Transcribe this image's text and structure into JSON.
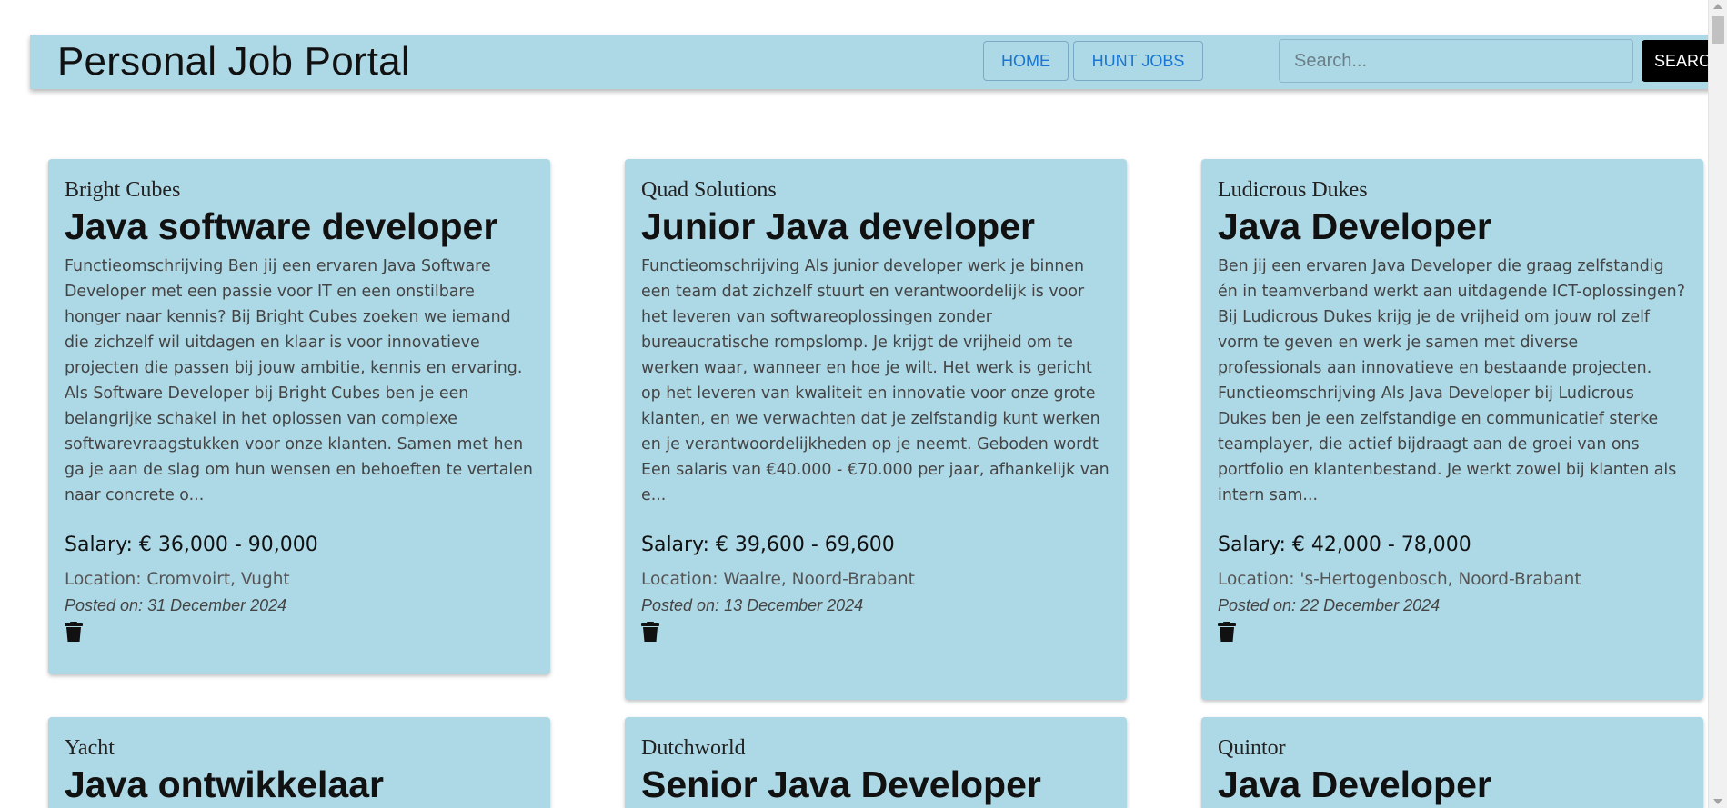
{
  "header": {
    "brand": "Personal Job Portal",
    "nav": [
      {
        "label": "HOME"
      },
      {
        "label": "HUNT JOBS"
      }
    ],
    "search": {
      "placeholder": "Search...",
      "button_label": "Search"
    }
  },
  "jobs": [
    {
      "company": "Bright Cubes",
      "title": "Java software developer",
      "description": "Functieomschrijving Ben jij een ervaren Java Software Developer met een passie voor IT en een onstilbare honger naar kennis? Bij Bright Cubes zoeken we iemand die zichzelf wil uitdagen en klaar is voor innovatieve projecten die passen bij jouw ambitie, kennis en ervaring. Als Software Developer bij Bright Cubes ben je een belangrijke schakel in het oplossen van complexe softwarevraagstukken voor onze klanten. Samen met hen ga je aan de slag om hun wensen en behoeften te vertalen naar concrete o...",
      "salary": "Salary: € 36,000 - 90,000",
      "location": "Location: Cromvoirt, Vught",
      "posted": "Posted on: 31 December 2024",
      "icon": "trash-icon"
    },
    {
      "company": "Quad Solutions",
      "title": "Junior Java developer",
      "description": "Functieomschrijving Als junior developer werk je binnen een team dat zichzelf stuurt en verantwoordelijk is voor het leveren van softwareoplossingen zonder bureaucratische rompslomp. Je krijgt de vrijheid om te werken waar, wanneer en hoe je wilt. Het werk is gericht op het leveren van kwaliteit en innovatie voor onze grote klanten, en we verwachten dat je zelfstandig kunt werken en je verantwoordelijkheden op je neemt. Geboden wordt Een salaris van €40.000 - €70.000 per jaar, afhankelijk van e...",
      "salary": "Salary: € 39,600 - 69,600",
      "location": "Location: Waalre, Noord-Brabant",
      "posted": "Posted on: 13 December 2024",
      "icon": "trash-icon"
    },
    {
      "company": "Ludicrous Dukes",
      "title": "Java Developer",
      "description": "Ben jij een ervaren Java Developer die graag zelfstandig én in teamverband werkt aan uitdagende ICT-oplossingen? Bij Ludicrous Dukes krijg je de vrijheid om jouw rol zelf vorm te geven en werk je samen met diverse professionals aan innovatieve en bestaande projecten. Functieomschrijving Als Java Developer bij Ludicrous Dukes ben je een zelfstandige en communicatief sterke teamplayer, die actief bijdraagt aan de groei van ons portfolio en klantenbestand. Je werkt zowel bij klanten als intern sam...",
      "salary": "Salary: € 42,000 - 78,000",
      "location": "Location: 's-Hertogenbosch, Noord-Brabant",
      "posted": "Posted on: 22 December 2024",
      "icon": "trash-icon"
    },
    {
      "company": "Yacht",
      "title": "Java ontwikkelaar"
    },
    {
      "company": "Dutchworld",
      "title": "Senior Java Developer"
    },
    {
      "company": "Quintor",
      "title": "Java Developer"
    }
  ]
}
